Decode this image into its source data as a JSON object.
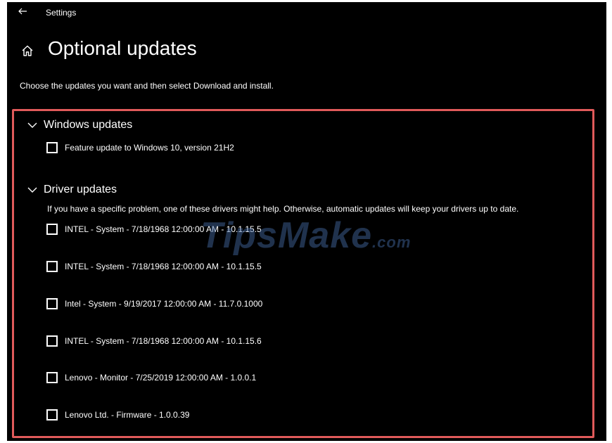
{
  "window": {
    "app_title": "Settings"
  },
  "page": {
    "title": "Optional updates",
    "subtitle": "Choose the updates you want and then select Download and install."
  },
  "sections": {
    "windows": {
      "title": "Windows updates",
      "items": [
        {
          "label": "Feature update to Windows 10, version 21H2",
          "checked": false
        }
      ]
    },
    "drivers": {
      "title": "Driver updates",
      "description": "If you have a specific problem, one of these drivers might help. Otherwise, automatic updates will keep your drivers up to date.",
      "items": [
        {
          "label": "INTEL - System - 7/18/1968 12:00:00 AM - 10.1.15.5",
          "checked": false
        },
        {
          "label": "INTEL - System - 7/18/1968 12:00:00 AM - 10.1.15.5",
          "checked": false
        },
        {
          "label": "Intel - System - 9/19/2017 12:00:00 AM - 11.7.0.1000",
          "checked": false
        },
        {
          "label": "INTEL - System - 7/18/1968 12:00:00 AM - 10.1.15.6",
          "checked": false
        },
        {
          "label": "Lenovo - Monitor - 7/25/2019 12:00:00 AM - 1.0.0.1",
          "checked": false
        },
        {
          "label": "Lenovo Ltd. - Firmware - 1.0.0.39",
          "checked": false
        }
      ]
    }
  },
  "watermark": {
    "main": "TipsMake",
    "suffix": ".com"
  },
  "icons": {
    "back": "back-arrow-icon",
    "home": "home-icon",
    "chevron": "chevron-down-icon",
    "checkbox": "checkbox-unchecked"
  },
  "colors": {
    "background": "#000000",
    "text": "#ffffff",
    "highlight": "#e05a5a"
  }
}
